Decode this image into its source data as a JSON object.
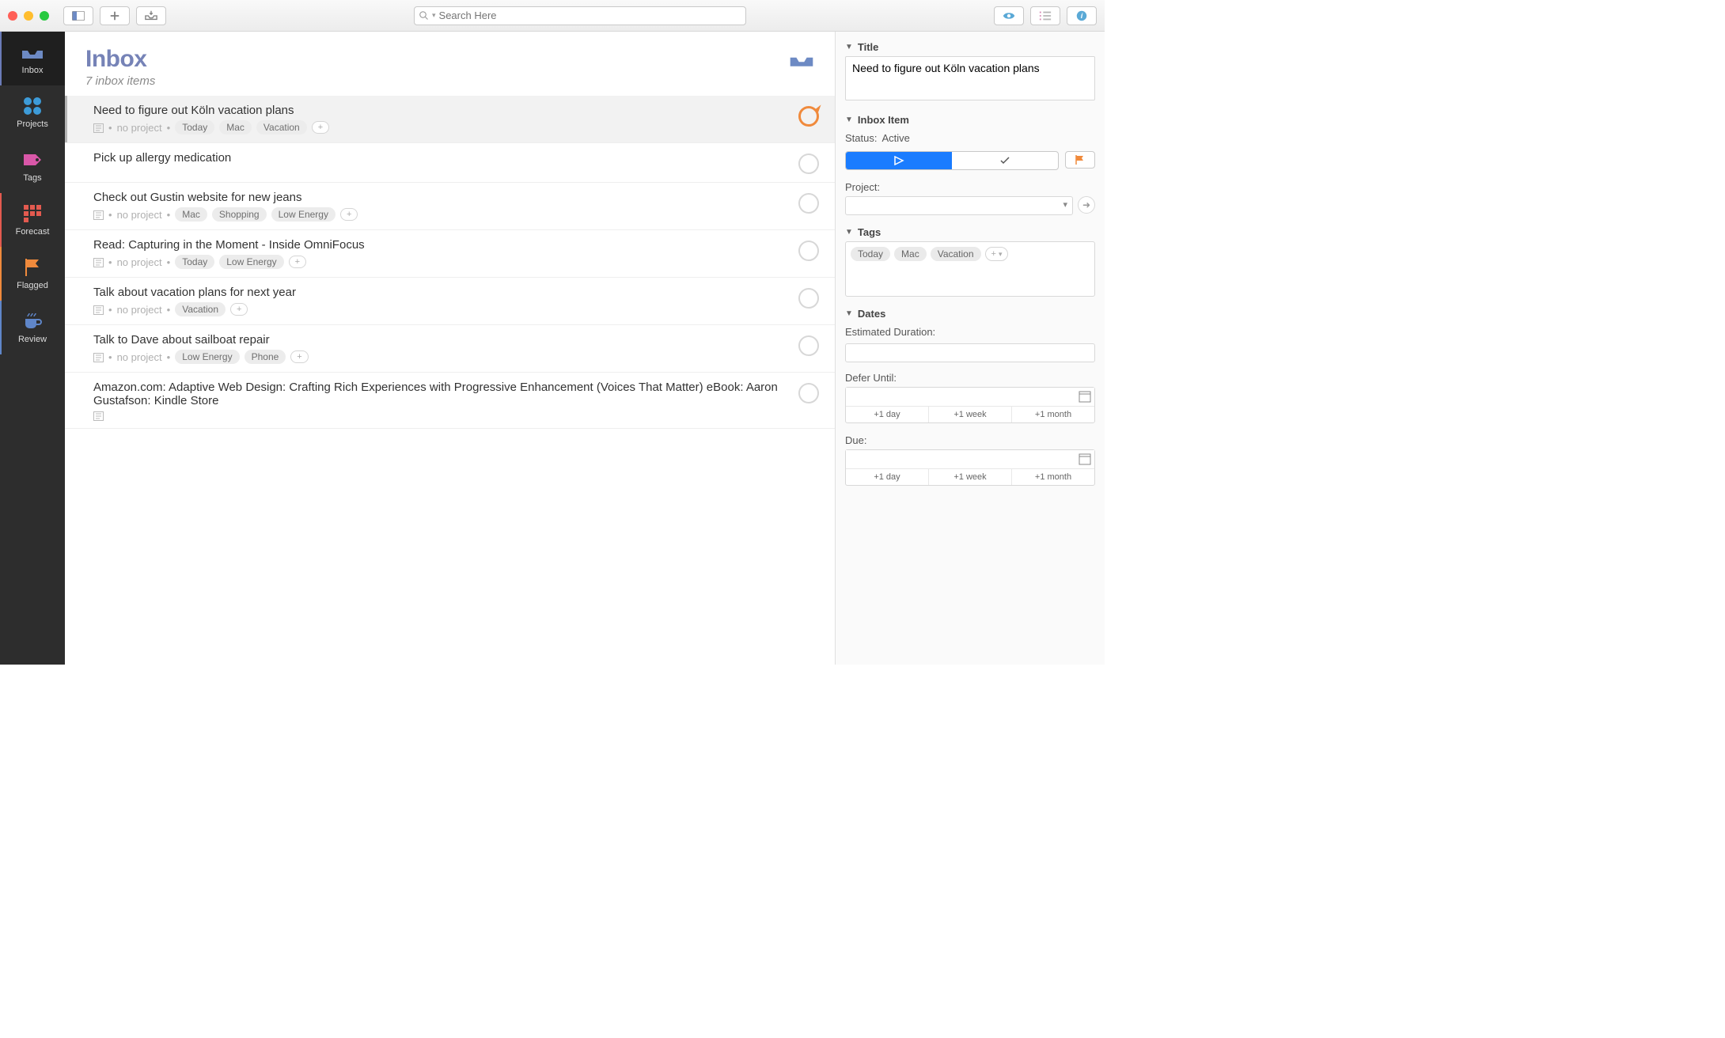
{
  "toolbar": {
    "search_placeholder": "Search Here"
  },
  "nav": {
    "items": [
      {
        "label": "Inbox"
      },
      {
        "label": "Projects"
      },
      {
        "label": "Tags"
      },
      {
        "label": "Forecast"
      },
      {
        "label": "Flagged"
      },
      {
        "label": "Review"
      }
    ]
  },
  "header": {
    "title": "Inbox",
    "subtitle": "7 inbox items"
  },
  "items": [
    {
      "title": "Need to figure out Köln vacation plans",
      "no_project": "no project",
      "tags": [
        "Today",
        "Mac",
        "Vacation"
      ],
      "selected": true,
      "flagged": true,
      "has_note": true
    },
    {
      "title": "Pick up allergy medication",
      "no_project": null,
      "tags": [],
      "selected": false,
      "flagged": false,
      "has_note": false
    },
    {
      "title": "Check out Gustin website for new jeans",
      "no_project": "no project",
      "tags": [
        "Mac",
        "Shopping",
        "Low Energy"
      ],
      "selected": false,
      "flagged": false,
      "has_note": true
    },
    {
      "title": "Read: Capturing in the Moment - Inside OmniFocus",
      "no_project": "no project",
      "tags": [
        "Today",
        "Low Energy"
      ],
      "selected": false,
      "flagged": false,
      "has_note": true
    },
    {
      "title": "Talk about vacation plans for next year",
      "no_project": "no project",
      "tags": [
        "Vacation"
      ],
      "selected": false,
      "flagged": false,
      "has_note": true
    },
    {
      "title": "Talk to Dave about sailboat repair",
      "no_project": "no project",
      "tags": [
        "Low Energy",
        "Phone"
      ],
      "selected": false,
      "flagged": false,
      "has_note": true
    },
    {
      "title": "Amazon.com: Adaptive Web Design: Crafting Rich Experiences with Progressive Enhancement (Voices That Matter) eBook: Aaron Gustafson: Kindle Store",
      "no_project": null,
      "tags": [],
      "selected": false,
      "flagged": false,
      "has_note": true
    }
  ],
  "inspector": {
    "title_label": "Title",
    "title_value": "Need to figure out Köln vacation plans",
    "inbox_label": "Inbox Item",
    "status_label": "Status:",
    "status_value": "Active",
    "project_label": "Project:",
    "tags_label": "Tags",
    "tags": [
      "Today",
      "Mac",
      "Vacation"
    ],
    "dates_label": "Dates",
    "estimated_label": "Estimated Duration:",
    "defer_label": "Defer Until:",
    "due_label": "Due:",
    "quick": {
      "d": "+1 day",
      "w": "+1 week",
      "m": "+1 month"
    }
  }
}
